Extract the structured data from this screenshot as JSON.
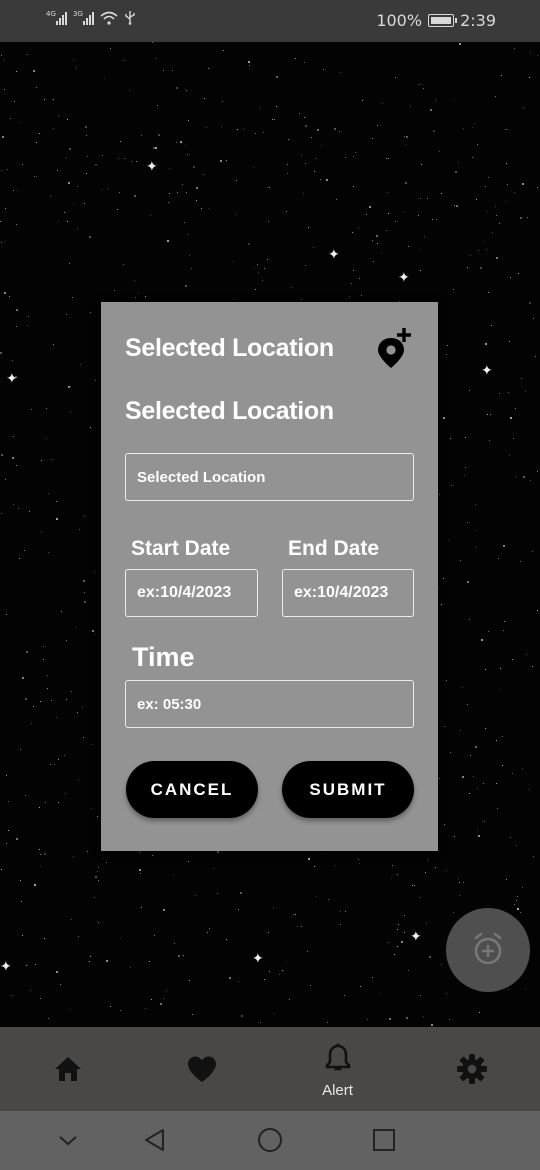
{
  "status_bar": {
    "network_1": "4G",
    "network_2": "3G",
    "battery_percent": "100%",
    "time": "2:39",
    "icons": [
      "signal-icon",
      "signal-icon",
      "wifi-icon",
      "usb-icon",
      "battery-icon"
    ]
  },
  "dialog": {
    "title": "Selected Location",
    "subtitle": "Selected Location",
    "add_location_icon": "add-location-pin-icon",
    "location_placeholder": "Selected Location",
    "start_date_label": "Start Date",
    "end_date_label": "End Date",
    "start_date_placeholder": "ex:10/4/2023",
    "end_date_placeholder": "ex:10/4/2023",
    "time_label": "Time",
    "time_placeholder": "ex: 05:30",
    "cancel_label": "CANCEL",
    "submit_label": "SUBMIT"
  },
  "fab": {
    "icon": "add-alarm-icon"
  },
  "bottom_nav": {
    "items": [
      {
        "icon": "home-icon",
        "label": ""
      },
      {
        "icon": "heart-icon",
        "label": ""
      },
      {
        "icon": "bell-icon",
        "label": "Alert",
        "active": true
      },
      {
        "icon": "gear-icon",
        "label": ""
      }
    ]
  },
  "system_nav": {
    "icons": [
      "chevron-down-icon",
      "back-icon",
      "home-circle-icon",
      "recents-icon"
    ]
  },
  "colors": {
    "dialog_bg": "#939393",
    "button_bg": "#000000",
    "nav_bg": "#4a4846",
    "system_nav_bg": "#626262",
    "status_bar_bg": "#3a3a3a"
  }
}
